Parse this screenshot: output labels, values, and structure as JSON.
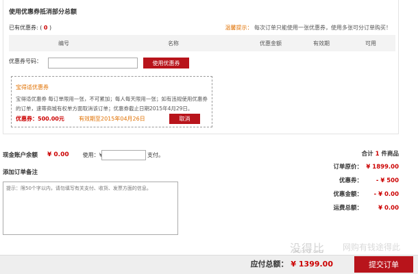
{
  "coupon": {
    "title": "使用优惠券抵消部分总额",
    "have_label": "已有优惠券: (",
    "have_count": "0",
    "have_close": ")",
    "tip_label": "温馨提示：",
    "tip_text": "每次订单只能使用一张优惠券，使用多张可分订单购买！",
    "columns": [
      "编号",
      "名称",
      "优惠金额",
      "有效期",
      "可用"
    ],
    "code_label": "优惠券号码：",
    "code_value": "",
    "use_button": "使用优惠券",
    "card": {
      "name": "宝得适优惠券",
      "desc": "宝得适优惠券 每订单限用一张，不可累加；每人每天限用一张；如有违规使用优惠券的订单，速蒂商城有权单方面取消该订单；优惠券截止日期2015年4月29日。",
      "value_label": "优惠券：500.00元",
      "valid_label": "有效期至2015年04月26日",
      "cancel_button": "取消"
    }
  },
  "cash": {
    "label": "现金账户余额",
    "value": "¥ 0.00",
    "use_label": "使用：¥",
    "input_value": "",
    "pay_suffix": "支付。"
  },
  "remark": {
    "title": "添加订单备注",
    "placeholder": "提示：限50个字以内，请勿填写有关支付、收货、发票方面的信息。"
  },
  "summary": {
    "total_prefix": "合计",
    "total_count": "1",
    "total_suffix": "件商品",
    "original_label": "订单原价：",
    "original_value": "¥ 1899.00",
    "coupon_label": "优惠券：",
    "coupon_value": "- ¥ 500",
    "discount_label": "优惠金额：",
    "discount_value": "- ¥ 0.00",
    "shipping_label": "运费总额：",
    "shipping_value": "¥ 0.00"
  },
  "footer": {
    "pay_label": "应付总额：",
    "pay_value": "¥ 1399.00",
    "submit_button": "提交订单"
  },
  "watermark": {
    "main": "没得比",
    "sub": "Meidebi.com",
    "slogan": "网购有钱途得此"
  },
  "colors": {
    "accent": "#b8141b",
    "price": "#cc0000",
    "tip": "#e07000"
  }
}
